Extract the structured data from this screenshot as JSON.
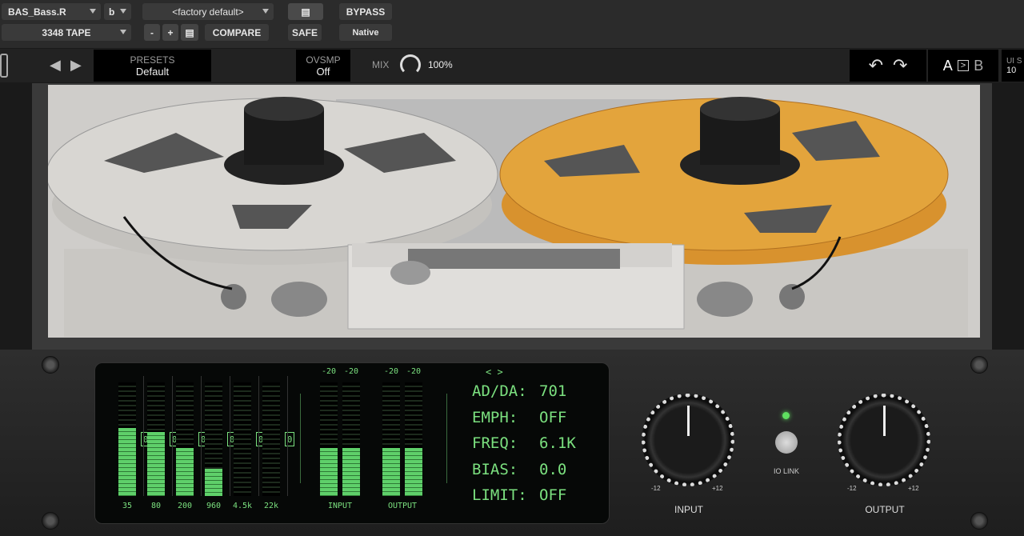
{
  "host": {
    "track": "BAS_Bass.R",
    "track_suffix": "b",
    "plugin": "3348 TAPE",
    "preset": "<factory default>",
    "minus": "-",
    "plus": "+",
    "compare": "COMPARE",
    "safe": "SAFE",
    "bypass": "BYPASS",
    "native": "Native"
  },
  "toolbar": {
    "presets_label": "PRESETS",
    "presets_value": "Default",
    "ovsmp_label": "OVSMP",
    "ovsmp_value": "Off",
    "mix_label": "MIX",
    "mix_value": "100%",
    "mix_level": 1.0,
    "a": "A",
    "b": "B",
    "ui_label": "UI S",
    "ui_value": "10"
  },
  "display": {
    "bands": [
      {
        "label": "35",
        "level": 0.6,
        "value": "0"
      },
      {
        "label": "80",
        "level": 0.56,
        "value": "0"
      },
      {
        "label": "200",
        "level": 0.42,
        "value": "0"
      },
      {
        "label": "960",
        "level": 0.24,
        "value": "0"
      },
      {
        "label": "4.5k",
        "level": 0,
        "value": "0"
      },
      {
        "label": "22k",
        "level": 0,
        "value": "0"
      }
    ],
    "input": {
      "label": "INPUT",
      "ch": [
        {
          "peak": "-20",
          "level": 0.42
        },
        {
          "peak": "-20",
          "level": 0.42
        }
      ]
    },
    "output": {
      "label": "OUTPUT",
      "ch": [
        {
          "peak": "-20",
          "level": 0.42
        },
        {
          "peak": "-20",
          "level": 0.42
        }
      ]
    },
    "nav": "< >",
    "params": [
      {
        "k": "AD/DA:",
        "v": "701"
      },
      {
        "k": "EMPH:",
        "v": "OFF"
      },
      {
        "k": "FREQ:",
        "v": "6.1K"
      },
      {
        "k": "BIAS:",
        "v": "0.0"
      },
      {
        "k": "LIMIT:",
        "v": "OFF"
      }
    ]
  },
  "controls": {
    "input_label": "INPUT",
    "output_label": "OUTPUT",
    "io_link": "IO LINK",
    "min": "-12",
    "max": "+12",
    "led_color": "#5fe060"
  },
  "colors": {
    "reel_left": "#d6d4d0",
    "reel_right": "#e3a43c",
    "meter_green": "#5fd06a"
  }
}
